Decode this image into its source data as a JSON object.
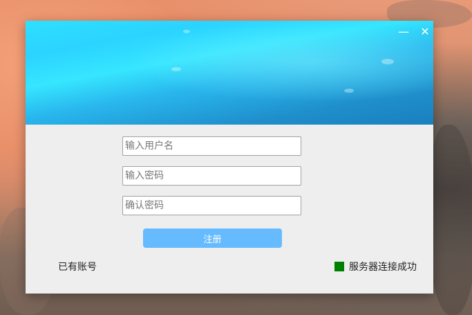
{
  "window": {
    "minimize_glyph": "—",
    "close_glyph": "✕"
  },
  "form": {
    "username_placeholder": "输入用户名",
    "password_placeholder": "输入密码",
    "confirm_placeholder": "确认密码",
    "username_value": "",
    "password_value": "",
    "confirm_value": "",
    "register_label": "注册"
  },
  "footer": {
    "has_account_label": "已有账号",
    "server_status_text": "服务器连接成功",
    "server_status_color": "#008000"
  }
}
